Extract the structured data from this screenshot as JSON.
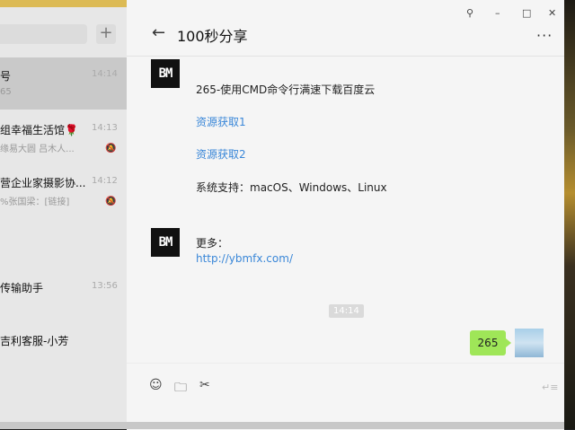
{
  "window": {
    "controls": [
      "⚲",
      "–",
      "□",
      "✕"
    ]
  },
  "sidebar": {
    "add_label": "+",
    "chats": [
      {
        "name": "号",
        "sub": "65",
        "time": "14:14",
        "muted": false,
        "selected": true
      },
      {
        "name": "组幸福生活馆🌹",
        "sub": "缘易大圆  吕木人...",
        "time": "14:13",
        "muted": true,
        "selected": false
      },
      {
        "name": "营企业家摄影协...",
        "sub": "%张国梁：[链接]",
        "time": "14:12",
        "muted": true,
        "selected": false
      },
      {
        "name": "传输助手",
        "sub": "",
        "time": "13:56",
        "muted": false,
        "selected": false
      },
      {
        "name": "吉利客服-小芳",
        "sub": "",
        "time": "",
        "muted": false,
        "selected": false
      }
    ]
  },
  "header": {
    "back_icon": "←",
    "title": "100秒分享",
    "more_icon": "···"
  },
  "messages": {
    "avatar_text": "BM",
    "msg1": {
      "title": "265-使用CMD命令行满速下载百度云",
      "link1": "资源获取1",
      "link2": "资源获取2",
      "support": "系统支持：macOS、Windows、Linux"
    },
    "msg2": {
      "more_label": "更多：",
      "url": "http://ybmfx.com/"
    },
    "time_badge": "14:14",
    "my_bubble": "265"
  },
  "input": {
    "emoji_icon": "☺",
    "folder_icon": "🗀",
    "scissors_icon": "✂",
    "send_icon": "↵≡"
  },
  "colors": {
    "bubble": "#9fe658",
    "link": "#3a87d8",
    "sidebar": "#e7e7e7",
    "main": "#f5f5f5"
  }
}
